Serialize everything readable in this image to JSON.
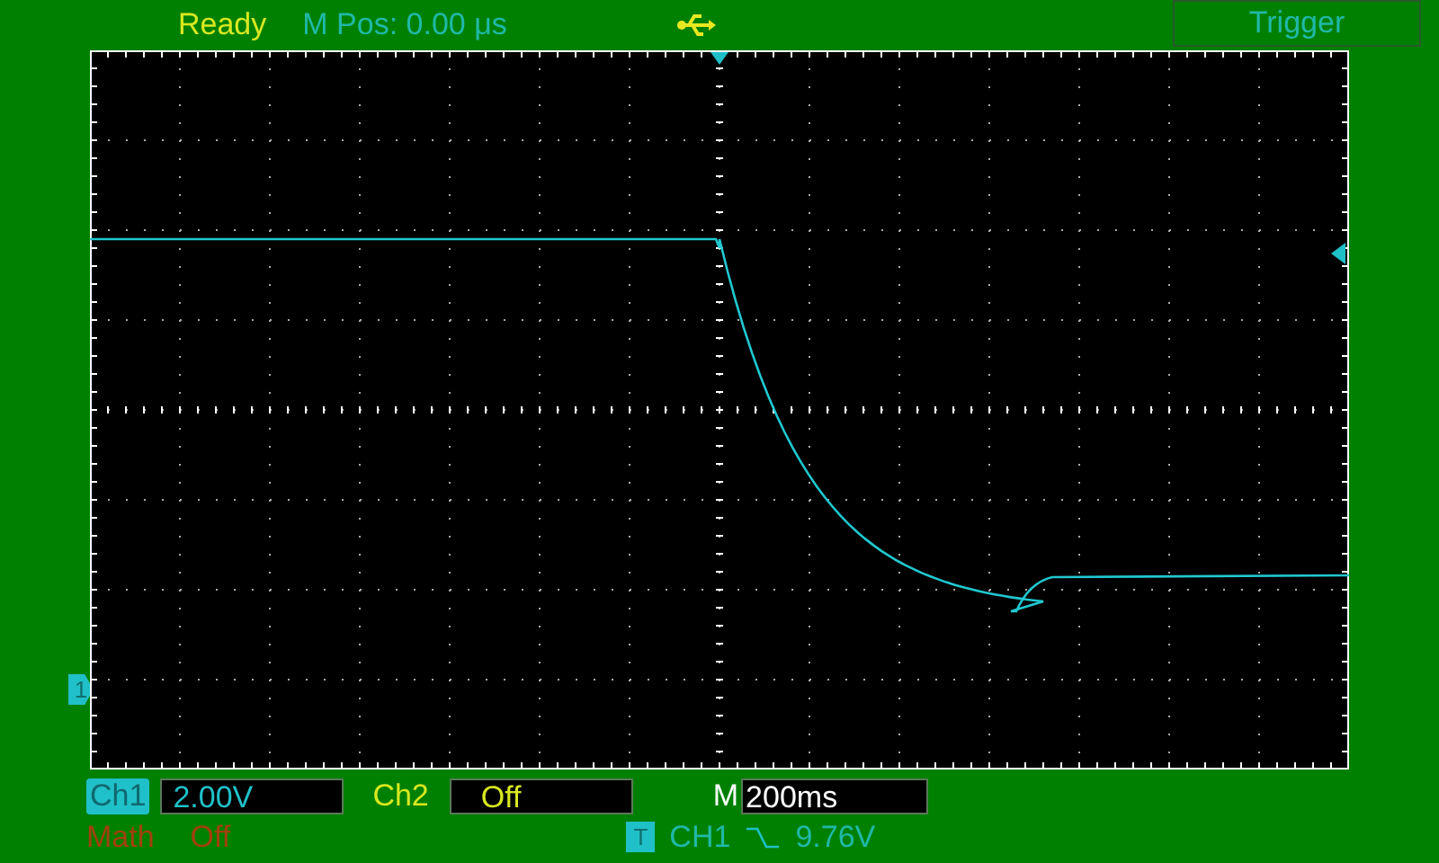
{
  "status_bar": {
    "state": "Ready",
    "m_pos": "M Pos: 0.00 μs",
    "trigger_button": "Trigger"
  },
  "markers": {
    "ground": "1"
  },
  "channels": [
    {
      "label": "Ch1",
      "value": "2.00V",
      "selected": true,
      "color": "#20c0c8"
    },
    {
      "label": "Ch2",
      "value": "Off",
      "selected": false,
      "color": "#d8e820"
    }
  ],
  "math": {
    "label": "Math",
    "value": "Off"
  },
  "timebase": {
    "label": "M",
    "value": "200ms"
  },
  "trigger_info": {
    "badge": "T",
    "source": "CH1",
    "level": "9.76V"
  }
}
